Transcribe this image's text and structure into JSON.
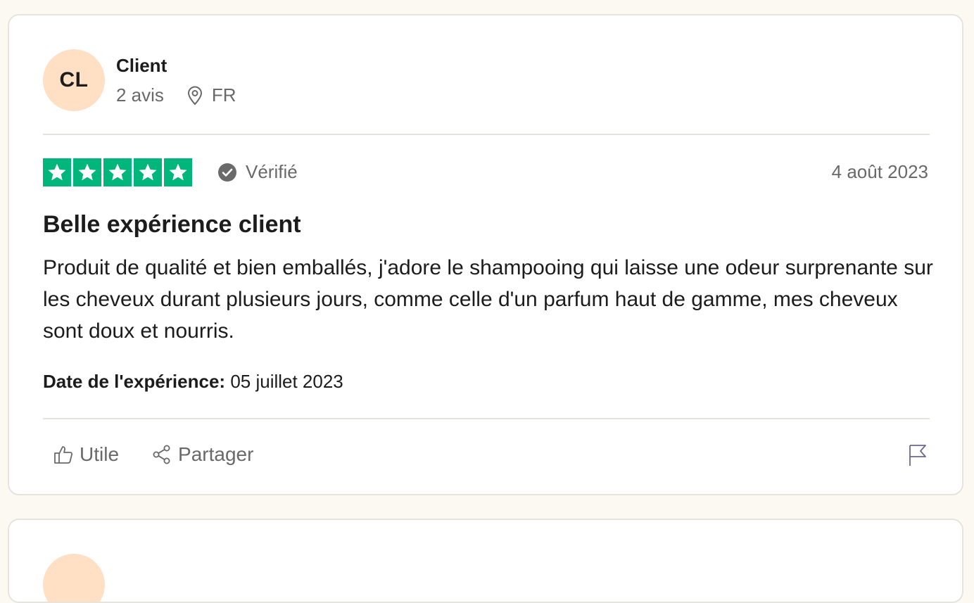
{
  "review": {
    "avatar_initials": "CL",
    "user_name": "Client",
    "review_count": "2 avis",
    "country": "FR",
    "rating": 5,
    "star_color": "#00b67a",
    "verified_label": "Vérifié",
    "date": "4 août 2023",
    "title": "Belle expérience client",
    "body": "Produit de qualité et bien emballés, j'adore le shampooing qui laisse une odeur surprenante sur les cheveux durant plusieurs jours, comme celle d'un parfum haut de gamme, mes cheveux sont doux et nourris.",
    "experience_label": "Date de l'expérience:",
    "experience_date": "05 juillet 2023",
    "actions": {
      "useful_label": "Utile",
      "share_label": "Partager"
    },
    "icons": {
      "location": "location-pin-icon",
      "verified": "check-circle-icon",
      "useful": "thumbs-up-icon",
      "share": "share-icon",
      "report": "flag-icon"
    }
  }
}
